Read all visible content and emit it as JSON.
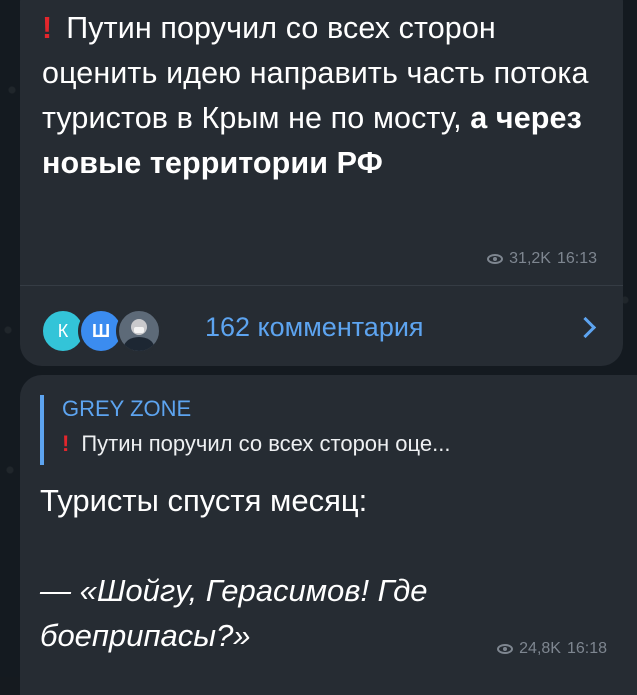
{
  "post1": {
    "exclaim_icon": "red-exclamation-icon",
    "line1": "Путин поручил со всех сторон оценить идею направить часть потока туристов в Крым не по мосту,",
    "line_bold": "а через новые территории РФ",
    "views": "31,2K",
    "time": "16:13"
  },
  "comments": {
    "avatars": [
      "К",
      "Ш",
      ""
    ],
    "label": "162 комментария"
  },
  "post2": {
    "reply": {
      "author": "GREY ZONE",
      "preview": "Путин поручил со всех сторон оце..."
    },
    "line1": "Туристы спустя месяц:",
    "quote": "— «Шойгу, Герасимов! Где боеприпасы?»",
    "views": "24,8K",
    "time": "16:18"
  },
  "colors": {
    "bubble": "#262c33",
    "accent": "#5da4f0",
    "alert": "#e3262c",
    "meta": "#7e8690"
  }
}
